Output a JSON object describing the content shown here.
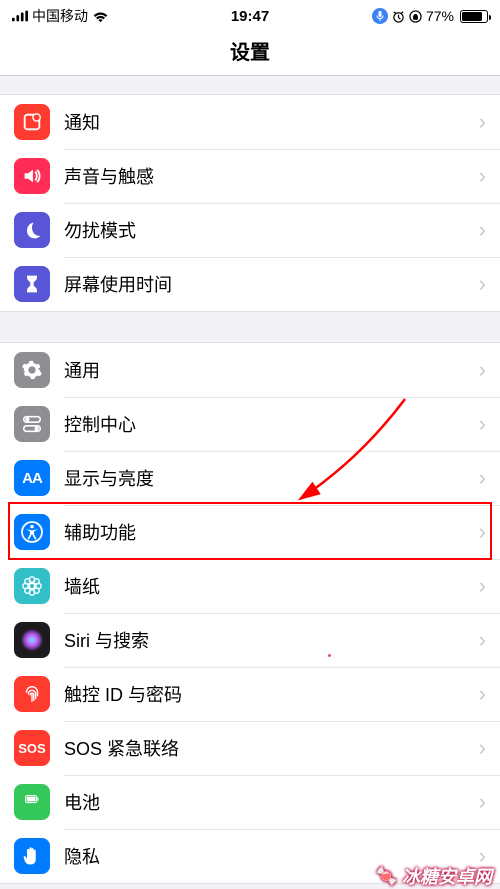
{
  "status": {
    "carrier": "中国移动",
    "time": "19:47",
    "battery_pct": "77%"
  },
  "header": {
    "title": "设置"
  },
  "groups": [
    {
      "rows": [
        {
          "id": "notifications",
          "label": "通知",
          "icon_bg": "#ff3b30",
          "icon": "notification"
        },
        {
          "id": "sounds",
          "label": "声音与触感",
          "icon_bg": "#ff2d55",
          "icon": "sound"
        },
        {
          "id": "dnd",
          "label": "勿扰模式",
          "icon_bg": "#5856d6",
          "icon": "moon"
        },
        {
          "id": "screentime",
          "label": "屏幕使用时间",
          "icon_bg": "#5856d6",
          "icon": "hourglass"
        }
      ]
    },
    {
      "rows": [
        {
          "id": "general",
          "label": "通用",
          "icon_bg": "#8e8e93",
          "icon": "gear"
        },
        {
          "id": "control-center",
          "label": "控制中心",
          "icon_bg": "#8e8e93",
          "icon": "switches"
        },
        {
          "id": "display",
          "label": "显示与亮度",
          "icon_bg": "#007aff",
          "icon": "aa"
        },
        {
          "id": "accessibility",
          "label": "辅助功能",
          "icon_bg": "#007aff",
          "icon": "accessibility",
          "highlighted": true
        },
        {
          "id": "wallpaper",
          "label": "墙纸",
          "icon_bg": "#33bfc8",
          "icon": "flower"
        },
        {
          "id": "siri",
          "label": "Siri 与搜索",
          "icon_bg": "#1c1c1e",
          "icon": "siri"
        },
        {
          "id": "touchid",
          "label": "触控 ID 与密码",
          "icon_bg": "#ff3b30",
          "icon": "fingerprint"
        },
        {
          "id": "sos",
          "label": "SOS 紧急联络",
          "icon_bg": "#ff3b30",
          "icon": "sos"
        },
        {
          "id": "battery",
          "label": "电池",
          "icon_bg": "#34c759",
          "icon": "battery"
        },
        {
          "id": "privacy",
          "label": "隐私",
          "icon_bg": "#007aff",
          "icon": "hand"
        }
      ]
    }
  ],
  "watermark": {
    "text": "冰糖安卓网"
  },
  "annotation": {
    "highlight_row": "accessibility",
    "arrow_color": "#ff0000"
  }
}
